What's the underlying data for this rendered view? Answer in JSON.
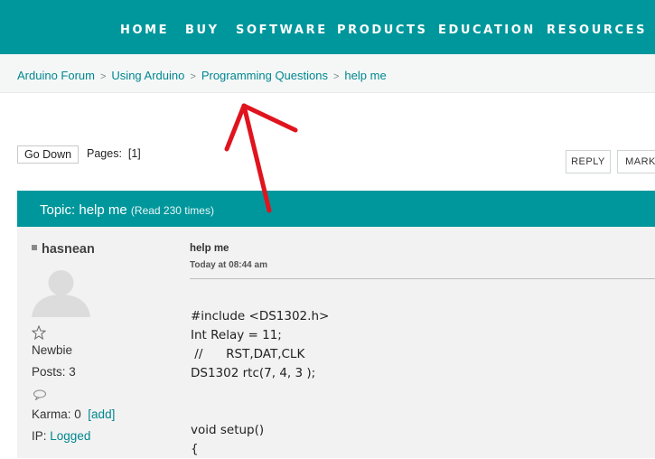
{
  "nav": [
    "HOME",
    "BUY",
    "SOFTWARE",
    "PRODUCTS",
    "EDUCATION",
    "RESOURCES"
  ],
  "breadcrumb": [
    "Arduino Forum",
    "Using Arduino",
    "Programming Questions",
    "help me"
  ],
  "toolbar": {
    "go_down": "Go Down",
    "pages_label": "Pages:",
    "pages_value": "[1]",
    "reply": "REPLY",
    "mark": "MARK"
  },
  "topic": {
    "prefix": "Topic:",
    "title": "help me",
    "reads": "(Read 230 times)"
  },
  "post": {
    "author": "hasnean",
    "rank": "Newbie",
    "posts": "Posts: 3",
    "karma": "Karma: 0",
    "karma_add": "[add]",
    "ip_label": "IP:",
    "ip_value": "Logged",
    "subject": "help me",
    "date": "Today at 08:44 am",
    "body": "#include <DS1302.h>\nInt Relay = 11;\n //      RST,DAT,CLK\nDS1302 rtc(7, 4, 3 );\n\n\nvoid setup()\n{"
  },
  "colors": {
    "brand_teal": "#00979c",
    "link": "#00878f",
    "annotation_arrow": "#e0141e"
  }
}
